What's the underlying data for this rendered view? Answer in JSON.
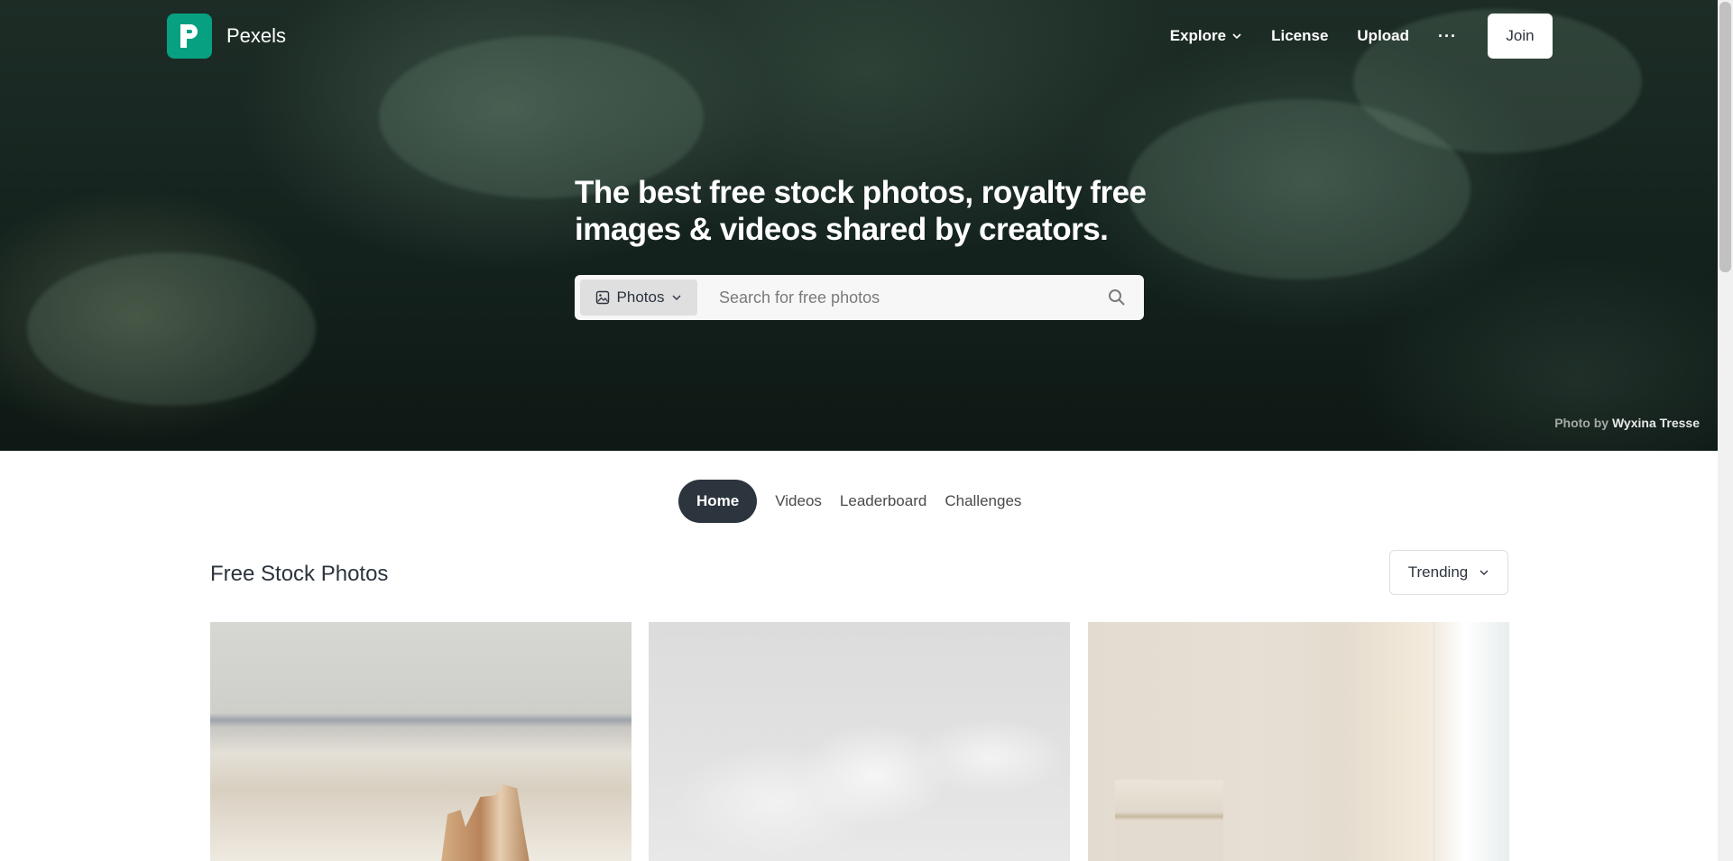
{
  "brand": {
    "name": "Pexels",
    "color": "#07a081"
  },
  "nav": {
    "explore": "Explore",
    "license": "License",
    "upload": "Upload",
    "more": "···",
    "join": "Join"
  },
  "hero": {
    "headline": "The best free stock photos, royalty free images & videos shared by creators.",
    "search": {
      "type_label": "Photos",
      "placeholder": "Search for free photos"
    },
    "credit": {
      "prefix": "Photo by",
      "author": "Wyxina Tresse"
    }
  },
  "tabs": [
    {
      "label": "Home",
      "active": true
    },
    {
      "label": "Videos"
    },
    {
      "label": "Leaderboard"
    },
    {
      "label": "Challenges"
    }
  ],
  "section": {
    "title": "Free Stock Photos",
    "sort_label": "Trending"
  },
  "icons": {
    "logo": "pexels-logo-icon",
    "explore_chevron": "chevron-down-icon",
    "search_type": "image-icon",
    "search": "search-icon",
    "sort_chevron": "chevron-down-icon"
  }
}
